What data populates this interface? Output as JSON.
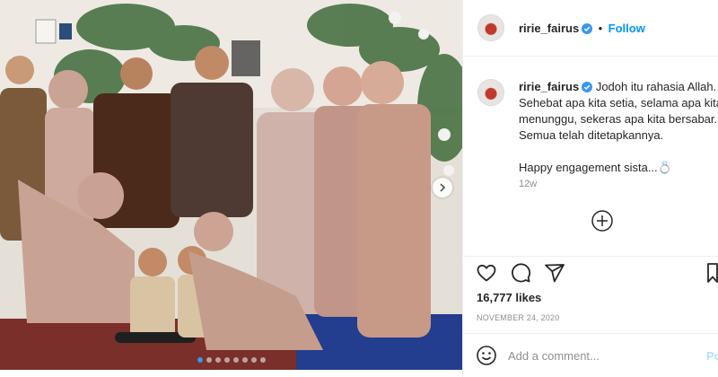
{
  "header": {
    "username": "ririe_fairus",
    "separator": "•",
    "follow_label": "Follow"
  },
  "caption": {
    "username": "ririe_fairus",
    "lines": [
      "Jodoh itu rahasia Allah.",
      "Sehebat apa kita setia, selama apa kita",
      "menunggu, sekeras apa kita bersabar.",
      "Semua telah ditetapkannya.",
      "",
      "Happy engagement sista...💍"
    ],
    "time_ago": "12w"
  },
  "actions": {
    "likes": "16,777 likes",
    "date": "NOVEMBER 24, 2020"
  },
  "comment": {
    "placeholder": "Add a comment...",
    "post_label": "Po"
  },
  "carousel": {
    "slides": 8,
    "active": 1
  },
  "colors": {
    "accent": "#0095f6",
    "verified": "#3897f0",
    "muted": "#8e8e8e",
    "border": "#efefef"
  },
  "icons": [
    "verified-icon",
    "next-arrow-icon",
    "more-comments-icon",
    "heart-icon",
    "comment-icon",
    "share-icon",
    "bookmark-icon",
    "emoji-icon"
  ]
}
